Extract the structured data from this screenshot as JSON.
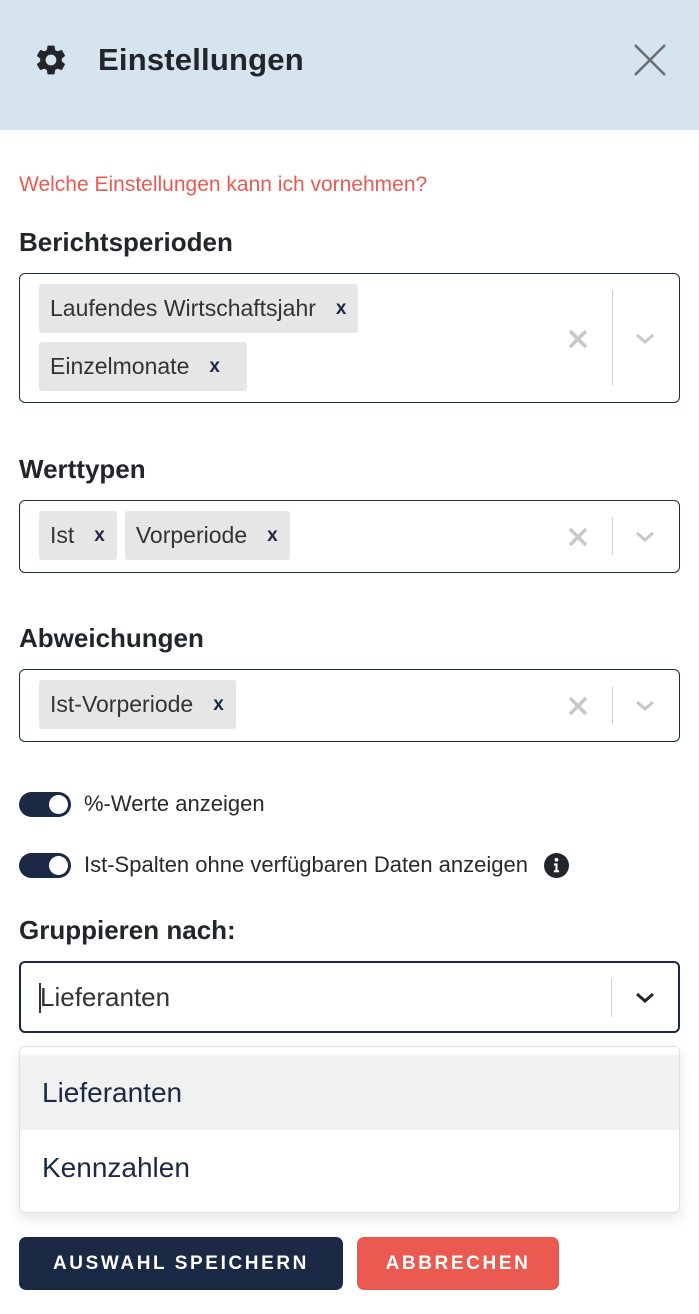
{
  "header": {
    "title": "Einstellungen",
    "icon": "gear-icon",
    "close_icon": "close-icon"
  },
  "help_link": "Welche Einstellungen kann ich vornehmen?",
  "fields": {
    "berichtsperioden": {
      "label": "Berichtsperioden",
      "chips": [
        "Laufendes Wirtschaftsjahr",
        "Einzelmonate"
      ],
      "chip_remove": "x"
    },
    "werttypen": {
      "label": "Werttypen",
      "chips": [
        "Ist",
        "Vorperiode"
      ],
      "chip_remove": "x"
    },
    "abweichungen": {
      "label": "Abweichungen",
      "chips": [
        "Ist-Vorperiode"
      ],
      "chip_remove": "x"
    }
  },
  "toggles": [
    {
      "label": "%-Werte anzeigen",
      "on": true
    },
    {
      "label": "Ist-Spalten ohne verfügbaren Daten anzeigen",
      "on": true,
      "info_icon": "info-icon"
    }
  ],
  "group_by": {
    "label": "Gruppieren nach:",
    "value": "Lieferanten",
    "options": [
      "Lieferanten",
      "Kennzahlen"
    ],
    "highlighted_option": "Lieferanten"
  },
  "buttons": {
    "save": "AUSWAHL SPEICHERN",
    "cancel": "ABBRECHEN"
  },
  "colors": {
    "header_bg": "#d6e4ef",
    "primary": "#1b2945",
    "accent": "#ea5a51",
    "link": "#e85a53"
  }
}
